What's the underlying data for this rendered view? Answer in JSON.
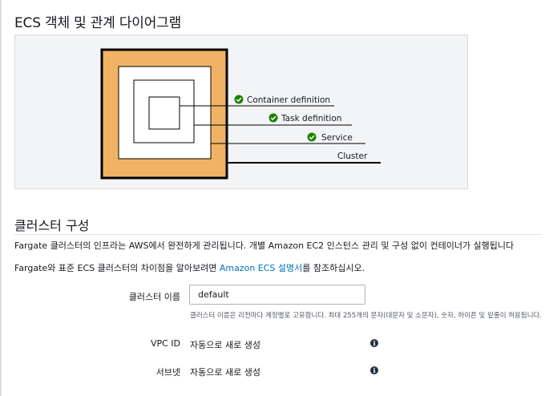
{
  "diagram": {
    "title": "ECS 객체 및 관계 다이어그램",
    "labels": {
      "container": "Container definition",
      "task": "Task definition",
      "service": "Service",
      "cluster": "Cluster"
    },
    "colors": {
      "cluster_fill": "#f0b365",
      "check_green": "#1d8102",
      "box_stroke": "#000000"
    }
  },
  "cluster_config": {
    "heading": "클러스터 구성",
    "desc1": "Fargate 클러스터의 인프라는 AWS에서 완전하게 관리됩니다. 개별 Amazon EC2 인스턴스 관리 및 구성 없이 컨테이너가 실행됩니다",
    "desc2_prefix": "Fargate와 표준 ECS 클러스터의 차이점을 알아보려면 ",
    "desc2_link": "Amazon ECS 설명서",
    "desc2_suffix": "를 참조하십시오.",
    "cluster_name_label": "클러스터 이름",
    "cluster_name_value": "default",
    "cluster_name_hint": "클러스터 이름은 리전마다 계정별로 고유합니다. 최대 255개의 문자(대문자 및 소문자), 숫자, 하이픈 및 밑줄이 허용됩니다.",
    "vpc_label": "VPC ID",
    "vpc_value": "자동으로 새로 생성",
    "subnet_label": "서브넷",
    "subnet_value": "자동으로 새로 생성"
  },
  "icons": {
    "check": "check-circle-icon",
    "info": "info-icon"
  }
}
